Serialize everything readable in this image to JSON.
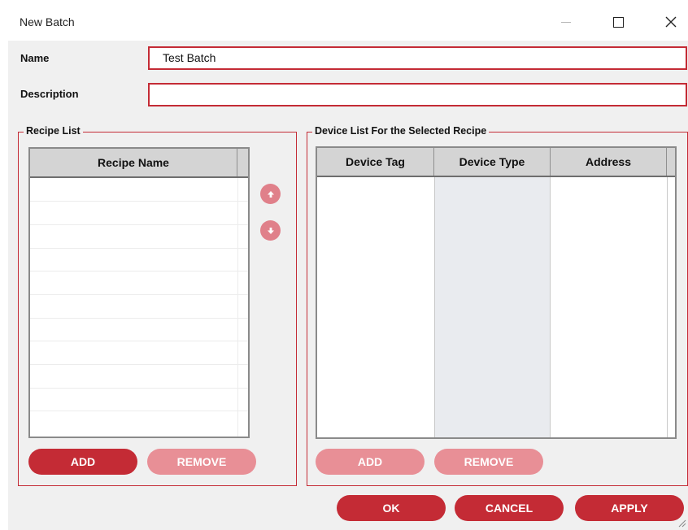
{
  "window": {
    "title": "New Batch",
    "controls": [
      "minimize-icon",
      "maximize-icon",
      "close-icon"
    ]
  },
  "form": {
    "name_label": "Name",
    "name_value": "Test Batch",
    "description_label": "Description",
    "description_value": ""
  },
  "recipe_list": {
    "legend": "Recipe List",
    "columns": [
      "Recipe Name"
    ],
    "rows": [],
    "move_up_icon": "arrow-up-icon",
    "move_down_icon": "arrow-down-icon",
    "add_label": "ADD",
    "remove_label": "REMOVE"
  },
  "device_list": {
    "legend": "Device List For the Selected Recipe",
    "columns": [
      "Device Tag",
      "Device Type",
      "Address"
    ],
    "rows": [],
    "add_label": "ADD",
    "remove_label": "REMOVE"
  },
  "footer": {
    "ok_label": "OK",
    "cancel_label": "CANCEL",
    "apply_label": "APPLY"
  },
  "colors": {
    "accent": "#c42b35",
    "accent_disabled": "#e88f96",
    "background": "#f0f0f0"
  }
}
